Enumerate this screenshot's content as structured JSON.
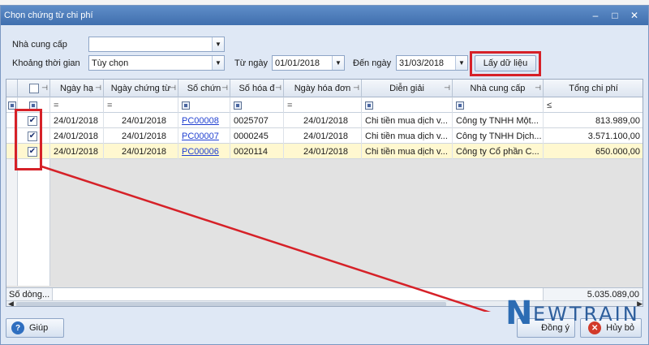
{
  "window": {
    "title": "Chọn chứng từ chi phí"
  },
  "filters": {
    "supplier_label": "Nhà cung cấp",
    "supplier_value": "",
    "period_label": "Khoảng thời gian",
    "period_value": "Tùy chọn",
    "from_label": "Từ ngày",
    "from_value": "01/01/2018",
    "to_label": "Đến ngày",
    "to_value": "31/03/2018",
    "fetch_button": "Lấy dữ liệu"
  },
  "grid": {
    "columns": [
      "Ngày hạ",
      "Ngày chứng từ",
      "Số chứn",
      "Số hóa đ",
      "Ngày hóa đơn",
      "Diễn giải",
      "Nhà cung cấp",
      "Tổng chi phí"
    ],
    "filter_row": [
      "=",
      "=",
      "",
      "",
      "=",
      "",
      "",
      "≤"
    ],
    "rows": [
      {
        "checked": true,
        "c0": "24/01/2018",
        "c1": "24/01/2018",
        "c2": "PC00008",
        "c3": "0025707",
        "c4": "24/01/2018",
        "c5": "Chi tiền mua dịch v...",
        "c6": "Công ty TNHH Một...",
        "c7": "813.989,00"
      },
      {
        "checked": true,
        "c0": "24/01/2018",
        "c1": "24/01/2018",
        "c2": "PC00007",
        "c3": "0000245",
        "c4": "24/01/2018",
        "c5": "Chi tiền mua dịch v...",
        "c6": "Công ty TNHH Dịch...",
        "c7": "3.571.100,00"
      },
      {
        "checked": true,
        "c0": "24/01/2018",
        "c1": "24/01/2018",
        "c2": "PC00006",
        "c3": "0020114",
        "c4": "24/01/2018",
        "c5": "Chi tiền mua dịch v...",
        "c6": "Công ty Cổ phần C...",
        "c7": "650.000,00"
      }
    ],
    "footer_label": "Số dòng...",
    "footer_total": "5.035.089,00"
  },
  "buttons": {
    "help": "Giúp",
    "ok": "Đồng ý",
    "cancel": "Hủy bỏ"
  },
  "logo": {
    "first": "N",
    "rest": "EWTRAIN"
  },
  "colors": {
    "highlight": "#d62128",
    "selected_row": "#fff8d0",
    "title_bar": "#4a7bbd"
  }
}
